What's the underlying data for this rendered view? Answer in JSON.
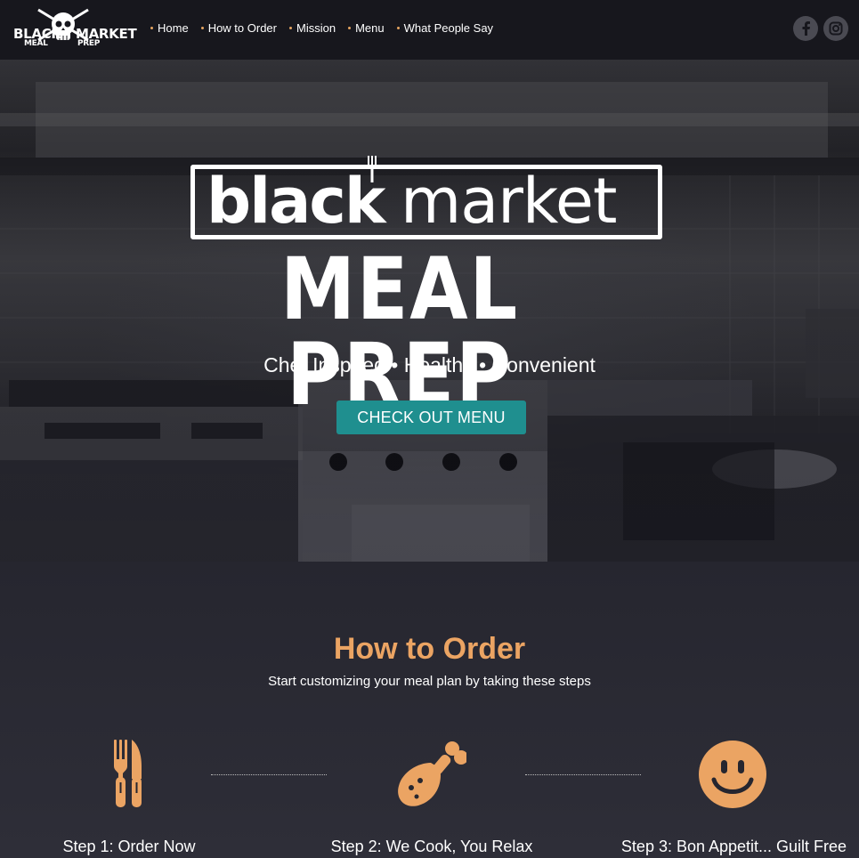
{
  "header": {
    "logo": {
      "word1": "BLACK",
      "word2": "MARKET",
      "word3": "MEAL",
      "word4": "PREP"
    },
    "nav": [
      {
        "label": "Home"
      },
      {
        "label": "How to Order"
      },
      {
        "label": "Mission"
      },
      {
        "label": "Menu"
      },
      {
        "label": "What People Say"
      }
    ],
    "social": [
      {
        "icon": "facebook-icon"
      },
      {
        "icon": "instagram-icon"
      }
    ]
  },
  "hero": {
    "brand_line1_bold": "black",
    "brand_line1_light": "market",
    "brand_line2": "MEAL PREP",
    "tagline": "Chef Inspired • Healthy • Convenient",
    "cta_label": "CHECK OUT MENU"
  },
  "how_to_order": {
    "title": "How to Order",
    "subtitle": "Start customizing your meal plan by taking these steps",
    "steps": [
      {
        "label": "Step 1: Order Now",
        "icon": "utensils-icon"
      },
      {
        "label": "Step 2: We Cook, You Relax",
        "icon": "drumstick-icon"
      },
      {
        "label": "Step 3: Bon Appetit... Guilt Free",
        "icon": "smiley-icon"
      }
    ]
  },
  "colors": {
    "accent": "#eba463",
    "cta": "#1f8f8f",
    "header_bg": "#17171d",
    "section_bg": "#26262f"
  }
}
